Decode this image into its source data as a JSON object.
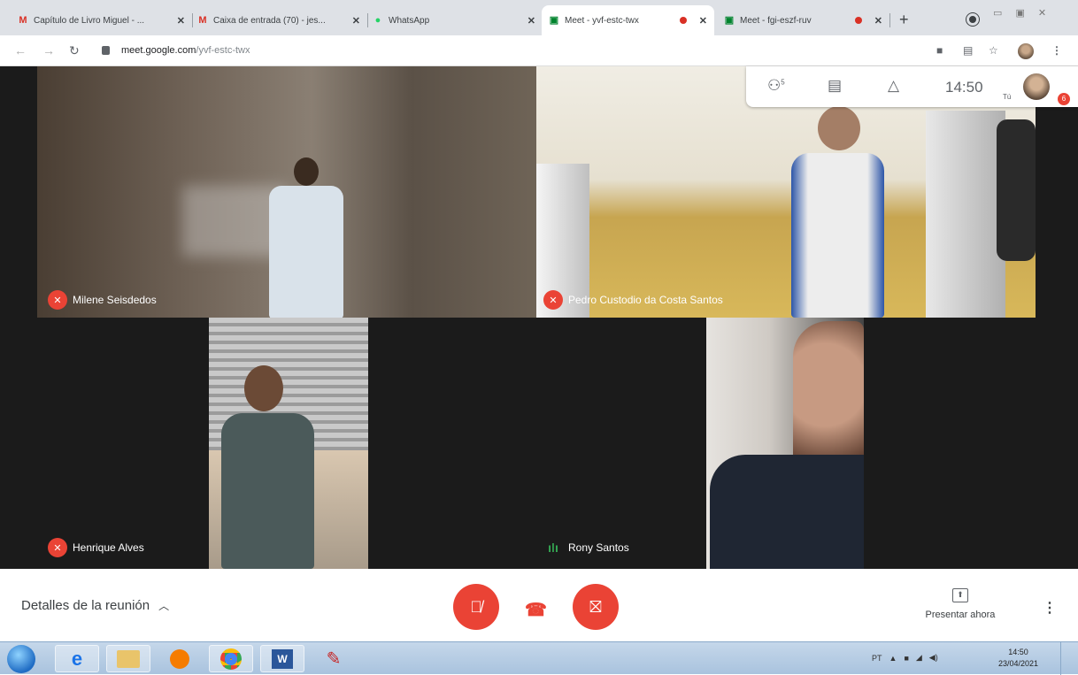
{
  "tabs": [
    {
      "title": "Capítulo de Livro Miguel - ...",
      "favicon": "gmail-icon"
    },
    {
      "title": "Caixa de entrada (70) - jes...",
      "favicon": "gmail-icon"
    },
    {
      "title": "WhatsApp",
      "favicon": "whatsapp-icon"
    },
    {
      "title": "Meet - yvf-estc-twx",
      "favicon": "meet-icon",
      "recording": true,
      "active": true
    },
    {
      "title": "Meet - fgi-eszf-ruv",
      "favicon": "meet-icon",
      "recording": true
    }
  ],
  "omnibox": {
    "domain": "meet.google.com",
    "path": "/yvf-estc-twx"
  },
  "meet_topbar": {
    "people_count": "5",
    "time": "14:50",
    "you_label": "Tú",
    "badge": "6"
  },
  "participants": [
    {
      "name": "Milene Seisdedos",
      "muted": true
    },
    {
      "name": "Pedro Custodio da Costa Santos",
      "muted": true
    },
    {
      "name": "Henrique Alves",
      "muted": true
    },
    {
      "name": "Rony Santos",
      "muted": false
    }
  ],
  "controls": {
    "meeting_details": "Detalles de la reunión",
    "present_now": "Presentar ahora"
  },
  "taskbar": {
    "language": "PT",
    "clock_time": "14:50",
    "clock_date": "23/04/2021"
  },
  "colors": {
    "accent_red": "#ea4335",
    "speaking_green": "#34a853"
  }
}
